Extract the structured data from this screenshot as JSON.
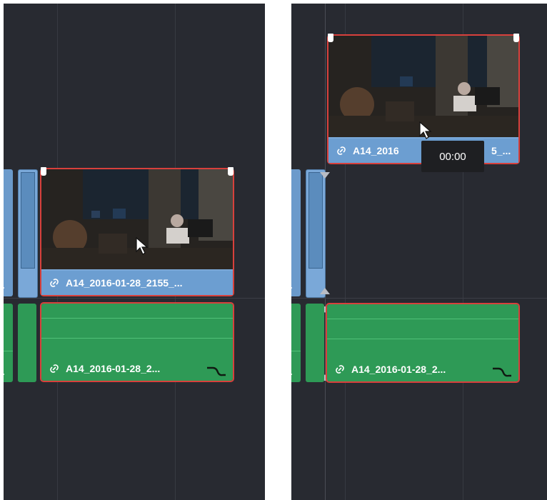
{
  "left_panel": {
    "video_clip": {
      "name": "A14_2016-01-28_2155_...",
      "link_icon": "link-icon"
    },
    "audio_clip": {
      "name": "A14_2016-01-28_2...",
      "link_icon": "link-icon",
      "curve_icon": "audio-curve-icon"
    },
    "cursor_icon": "pointer-cursor-icon"
  },
  "right_panel": {
    "video_clip": {
      "name_start": "A14_2016",
      "name_end": "5_...",
      "link_icon": "link-icon"
    },
    "audio_clip": {
      "name": "A14_2016-01-28_2...",
      "link_icon": "link-icon",
      "curve_icon": "audio-curve-icon"
    },
    "tooltip": {
      "text": "00:00"
    },
    "cursor_icon": "pointer-cursor-icon"
  },
  "colors": {
    "timeline_bg": "#282a31",
    "video_clip": "#7aa8d8",
    "audio_clip": "#2e9a56",
    "selection": "#d8403c",
    "tooltip_bg": "#1e1f22"
  }
}
